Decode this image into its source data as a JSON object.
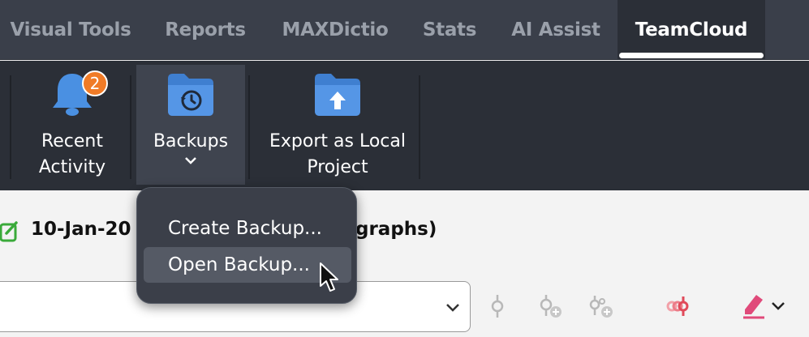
{
  "tabs": [
    {
      "label": "Visual Tools",
      "active": false
    },
    {
      "label": "Reports",
      "active": false
    },
    {
      "label": "MAXDictio",
      "active": false
    },
    {
      "label": "Stats",
      "active": false
    },
    {
      "label": "AI Assist",
      "active": false
    },
    {
      "label": "TeamCloud",
      "active": true
    }
  ],
  "ribbon": {
    "recent_activity": {
      "line1": "Recent",
      "line2": "Activity",
      "badge": "2",
      "icon": "bell-icon"
    },
    "backups": {
      "label": "Backups",
      "chevron": "⌄",
      "icon": "folder-history-icon"
    },
    "export_local": {
      "line1": "Export as Local",
      "line2": "Project",
      "icon": "folder-upload-icon"
    }
  },
  "dropdown": {
    "items": [
      "Create Backup...",
      "Open Backup..."
    ],
    "hovered_index": 1
  },
  "document": {
    "title_left": "10-Jan-20",
    "title_right": "graphs)",
    "icon": "checkbox-edit-icon"
  },
  "toolbar_icons": [
    "code-pin-icon",
    "code-pin-add-icon",
    "code-pin-multi-add-icon",
    "code-pins-highlight-icon",
    "highlighter-icon"
  ],
  "colors": {
    "tabbar_bg": "#3a3f4a",
    "ribbon_bg": "#2b2f37",
    "folder_blue": "#4a90e2",
    "badge_orange": "#f07b27",
    "check_green": "#3aaa3a",
    "highlighter_pink": "#e04a7a"
  }
}
